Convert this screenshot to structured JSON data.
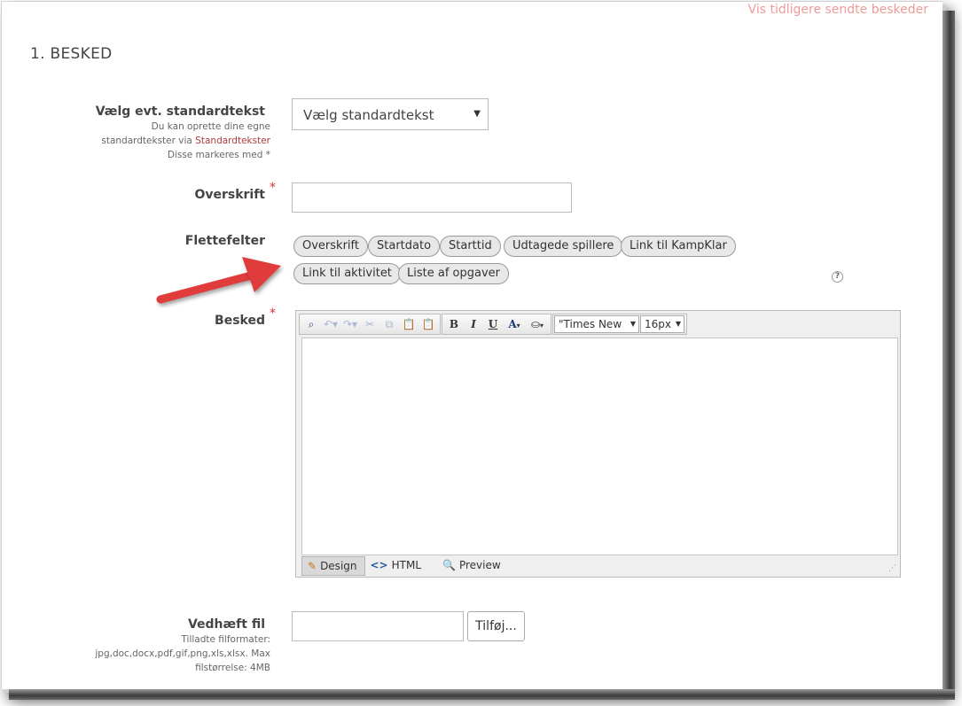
{
  "header": {
    "link": "Vis tidligere sendte beskeder"
  },
  "section": {
    "title": "1. BESKED"
  },
  "standard_text": {
    "label": "Vælg evt. standardtekst",
    "help_line1": "Du kan oprette dine egne",
    "help_line2_prefix": "standardtekster via",
    "help_link": "Standardtekster",
    "help_line3": "Disse markeres med *",
    "select_value": "Vælg standardtekst"
  },
  "heading": {
    "label": "Overskrift",
    "required_mark": "*",
    "value": ""
  },
  "merge_fields": {
    "label": "Flettefelter",
    "chips": [
      "Overskrift",
      "Startdato",
      "Starttid",
      "Udtagede spillere",
      "Link til KampKlar",
      "Link til aktivitet",
      "Liste af opgaver"
    ],
    "help_icon": "?"
  },
  "message": {
    "label": "Besked",
    "required_mark": "*",
    "toolbar": {
      "font_family": "\"Times New ...",
      "font_size": "16px",
      "bold": "B",
      "italic": "I",
      "underline": "U",
      "font_color": "A"
    },
    "modes": [
      "Design",
      "HTML",
      "Preview"
    ]
  },
  "attachment": {
    "label": "Vedhæft fil",
    "help_line1": "Tilladte filformater:",
    "help_line2": "jpg,doc,docx,pdf,gif,png,xls,xlsx. Max",
    "help_line3": "filstørrelse: 4MB",
    "button": "Tilføj..."
  },
  "colors": {
    "link_pink": "#f09a9a",
    "required_red": "#d9302c",
    "arrow_red": "#e03c3c"
  }
}
